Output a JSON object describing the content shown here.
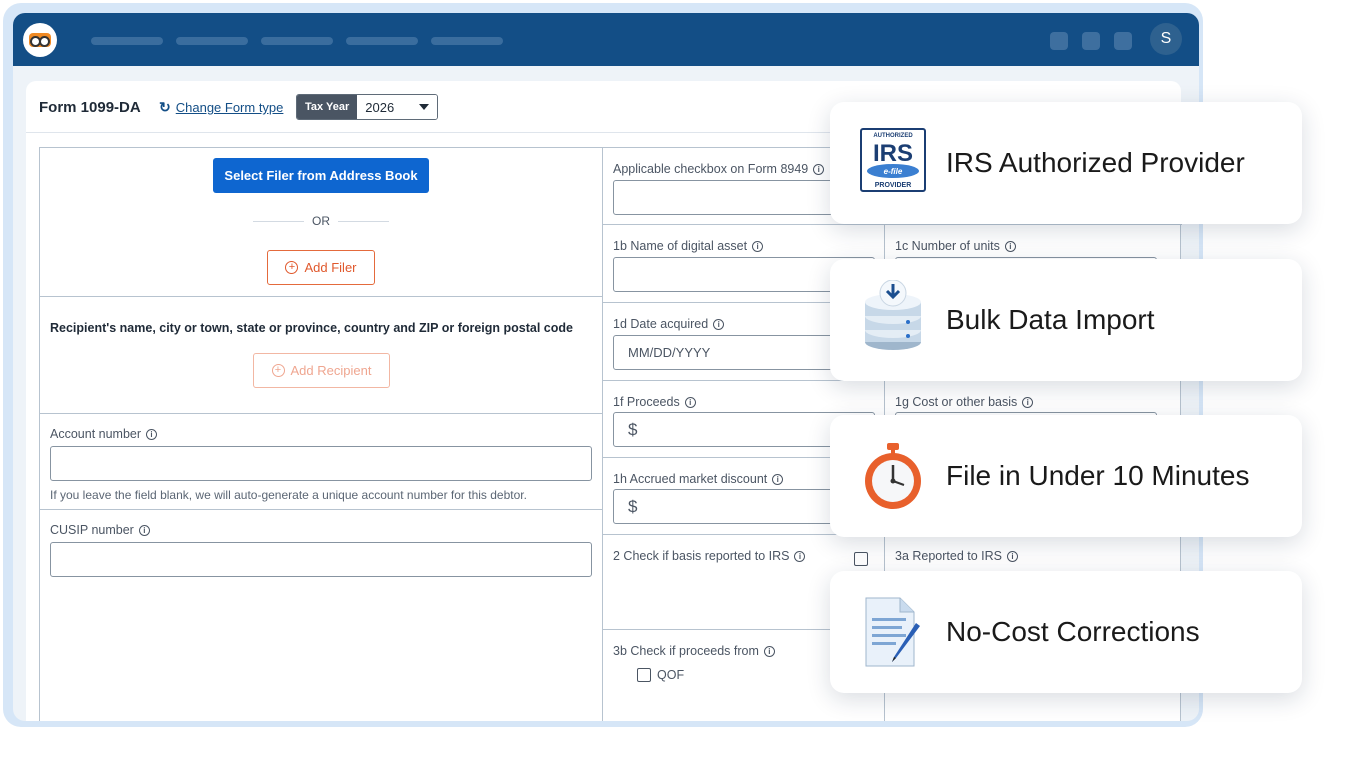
{
  "app": {
    "avatar_initial": "S"
  },
  "header": {
    "form_title": "Form 1099-DA",
    "change_link": "Change Form type",
    "tax_year_label": "Tax Year",
    "tax_year_value": "2026"
  },
  "filer": {
    "select_button": "Select Filer from Address Book",
    "or_text": "OR",
    "add_filer": "Add Filer"
  },
  "recipient": {
    "label": "Recipient's name, city or town, state or province, country and ZIP or foreign postal code",
    "add_recipient": "Add Recipient"
  },
  "account": {
    "label": "Account number",
    "value": "",
    "hint": "If you leave the field blank, we will auto-generate a unique account number for this debtor."
  },
  "cusip": {
    "label": "CUSIP number",
    "value": ""
  },
  "fields": {
    "applicable_checkbox": "Applicable checkbox on Form 8949",
    "f1b": "1b  Name of digital asset",
    "f1c": "1c  Number of units",
    "f1d": "1d  Date acquired",
    "f1d_placeholder": "MM/DD/YYYY",
    "f1f": "1f  Proceeds",
    "f1g": "1g  Cost or other basis",
    "f1h": "1h  Accrued market discount",
    "currency": "$",
    "f2": "2  Check if basis reported to IRS",
    "f3a": "3a  Reported to IRS",
    "f3b": "3b  Check if proceeds from",
    "qof": "QOF"
  },
  "features": [
    {
      "title": "IRS Authorized Provider",
      "icon": "irs-efile-badge-icon"
    },
    {
      "title": "Bulk Data Import",
      "icon": "database-download-icon"
    },
    {
      "title": "File in Under 10 Minutes",
      "icon": "stopwatch-icon"
    },
    {
      "title": "No-Cost Corrections",
      "icon": "document-pen-icon"
    }
  ],
  "badge": {
    "top": "AUTHORIZED",
    "main": "IRS",
    "efile": "e-file",
    "bottom": "PROVIDER"
  },
  "colors": {
    "topbar": "#134e86",
    "primary_button": "#0e66d0",
    "accent_orange": "#e0582c",
    "frame": "#d6e6f7"
  }
}
